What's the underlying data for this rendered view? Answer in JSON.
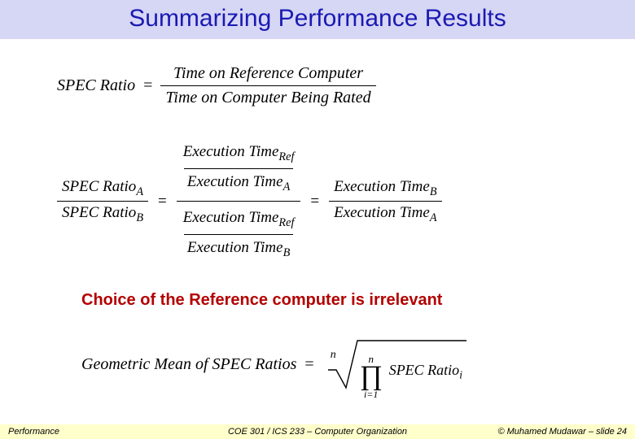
{
  "title": "Summarizing Performance Results",
  "eq1": {
    "lhs": "SPEC Ratio",
    "eq": "=",
    "num": "Time on Reference Computer",
    "den": "Time on Computer Being Rated"
  },
  "eq2": {
    "lhs_num": "SPEC Ratio",
    "lhs_num_sub": "A",
    "lhs_den": "SPEC Ratio",
    "lhs_den_sub": "B",
    "eq": "=",
    "mid_top_num": "Execution Time",
    "mid_top_num_sub": "Ref",
    "mid_top_den": "Execution Time",
    "mid_top_den_sub": "A",
    "mid_bot_num": "Execution Time",
    "mid_bot_num_sub": "Ref",
    "mid_bot_den": "Execution Time",
    "mid_bot_den_sub": "B",
    "rhs_num": "Execution Time",
    "rhs_num_sub": "B",
    "rhs_den": "Execution Time",
    "rhs_den_sub": "A"
  },
  "choice_text": "Choice of the Reference computer is irrelevant",
  "eq3": {
    "lhs": "Geometric Mean of SPEC Ratios",
    "eq": "=",
    "root_index": "n",
    "prod_top": "n",
    "prod_bot": "i=1",
    "term": "SPEC Ratio",
    "term_sub": "i"
  },
  "footer": {
    "left": "Performance",
    "center": "COE 301 / ICS 233 – Computer Organization",
    "right": "© Muhamed Mudawar – slide 24"
  }
}
